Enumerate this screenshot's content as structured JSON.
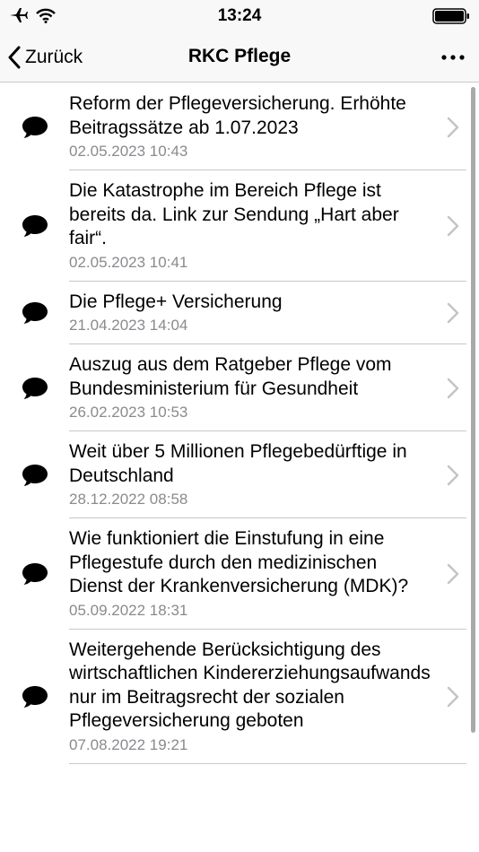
{
  "status": {
    "time": "13:24"
  },
  "nav": {
    "back_label": "Zurück",
    "title": "RKC Pflege"
  },
  "items": [
    {
      "title": "Reform der Pflegeversicherung. Erhöhte Beitragssätze ab 1.07.2023",
      "date": "02.05.2023 10:43"
    },
    {
      "title": "Die Katastrophe im Bereich Pflege ist bereits da. Link zur Sendung „Hart aber fair“.",
      "date": "02.05.2023 10:41"
    },
    {
      "title": "Die Pflege+ Versicherung",
      "date": "21.04.2023 14:04"
    },
    {
      "title": "Auszug aus dem Ratgeber Pflege vom Bundesministerium für Gesundheit",
      "date": "26.02.2023 10:53"
    },
    {
      "title": "Weit über 5 Millionen Pflegebedürftige in Deutschland",
      "date": "28.12.2022 08:58"
    },
    {
      "title": "Wie funktioniert die Einstufung in eine Pflegestufe durch den medizinischen Dienst der Krankenversicherung (MDK)?",
      "date": "05.09.2022 18:31"
    },
    {
      "title": "Weitergehende Berücksichtigung des wirtschaftlichen Kindererziehungsaufwands nur im Beitragsrecht der sozialen Pflegeversicherung geboten",
      "date": "07.08.2022 19:21"
    }
  ]
}
